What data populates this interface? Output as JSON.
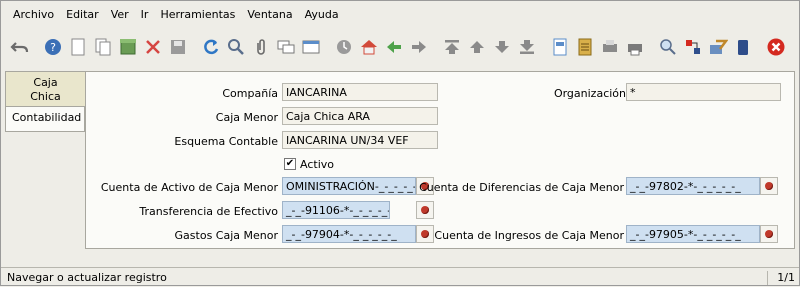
{
  "menu": {
    "items": [
      {
        "label": "Archivo"
      },
      {
        "label": "Editar"
      },
      {
        "label": "Ver"
      },
      {
        "label": "Ir"
      },
      {
        "label": "Herramientas"
      },
      {
        "label": "Ventana"
      },
      {
        "label": "Ayuda"
      }
    ]
  },
  "tabs": {
    "active": "Caja Chica",
    "active_line1": "Caja",
    "active_line2": "Chica",
    "inactive": "Contabilidad"
  },
  "form": {
    "company_label": "Compañía",
    "company_value": "IANCARINA",
    "org_label": "Organización",
    "org_value": "*",
    "cashbox_label": "Caja Menor",
    "cashbox_value": "Caja Chica ARA",
    "schema_label": "Esquema Contable",
    "schema_value": "IANCARINA UN/34 VEF",
    "active_label": "Activo",
    "active_checked": "✔",
    "asset_label_pre": "",
    "asset_label": "Cuenta de Activo de Caja Menor",
    "asset_value": "OMINISTRACIÓN-_-_-_-_-_",
    "diff_label": "Cuenta de Diferencias de Caja Menor",
    "diff_value": "_-_-97802-*-_-_-_-_-_",
    "transfer_label": "Transferencia de Efectivo",
    "transfer_value": "_-_-91106-*-_-_-_-_-_",
    "expense_label": "Gastos Caja Menor",
    "expense_value": "_-_-97904-*-_-_-_-_-_",
    "income_label": "Cuenta de Ingresos de Caja Menor",
    "income_value": "_-_-97905-*-_-_-_-_-_"
  },
  "status": {
    "text": "Navegar o actualizar registro",
    "record": "1/1"
  },
  "colors": {
    "accent_field": "#cfe0f1",
    "readonly_field": "#f4f2ea",
    "close_icon": "#d42a20"
  }
}
